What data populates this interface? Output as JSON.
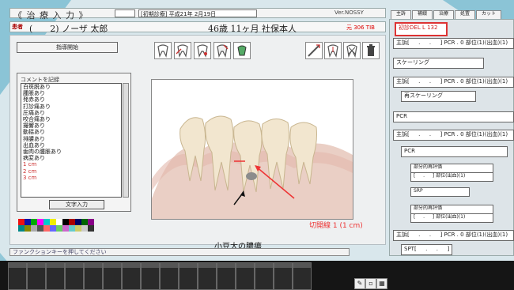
{
  "window": {
    "title": "《 治 療 入 力 》",
    "date": "[初期診療] 平成21年 2月19日",
    "version": "Ver.NOSSY"
  },
  "patient": {
    "id_label": "患者",
    "name": "(　　2) ノーザ 太郎",
    "info": "46歳 11ヶ月 社保本人",
    "code": "元 306 TIB"
  },
  "toolbar": {
    "instruction_button": "指導開始",
    "icons": [
      "tooth-icon",
      "tooth-arrow-icon",
      "tooth-mark-icon",
      "tooth-crown-icon",
      "tooth-brush-icon",
      "scaler-icon",
      "tooth-probe-icon",
      "tooth-x-icon",
      "trash-icon"
    ]
  },
  "comment_panel": {
    "label": "コメントを記録",
    "items": [
      "白斑脱あり",
      "腫脹あり",
      "発赤あり",
      "打診痛あり",
      "圧痛あり",
      "咬合痛あり",
      "撮響あり",
      "動揺あり",
      "排膿あり",
      "出血あり",
      "歯肉の腫脹あり",
      "病変あり",
      "1 cm",
      "2 cm",
      "3 cm"
    ],
    "text_input_button": "文字入力",
    "palette": [
      "#e11",
      "#11a",
      "#0a0",
      "#f0f",
      "#0cc",
      "#ee0",
      "#fff",
      "#000",
      "#a00",
      "#006",
      "#060",
      "#808",
      "#088",
      "#880",
      "#aaa",
      "#555",
      "#f66",
      "#66f",
      "#6c6",
      "#c6c",
      "#6cc",
      "#cc6",
      "#ccc",
      "#333"
    ]
  },
  "image": {
    "annotation_red": "切開線 1 (1 cm)",
    "annotation_black": "小豆大の膿瘍"
  },
  "status_bar": {
    "message": "ファンクションキーを押してください"
  },
  "right_panel": {
    "tabs": [
      "主訴",
      "補綴",
      "治療",
      "処置",
      "カット"
    ],
    "rows": [
      "初診DEL L 132",
      "主訴[ 　 . 　 . 　 ] PCR . 0 部位(1)(出血)(1)",
      "スケーリング",
      "主訴[ 　 . 　 . 　 ] PCR . 0 部位(1)(出血)(1)",
      "再スケーリング",
      "PCR",
      "主訴[ 　 . 　 . 　 ] PCR . 0 部位(1)(出血)(1)",
      "PCR",
      "部分的再評価",
      "[ 　 . 　 ] 部位(出血)(1)",
      "SRP",
      "部分的再評価",
      "[ 　 . 　 ] 部位(出血)(1)",
      "主訴[ 　 . 　 . 　 ] PCR . 0 部位(1)(出血)(1)",
      "SPT[ 　 . 　 . 　 ]"
    ]
  }
}
